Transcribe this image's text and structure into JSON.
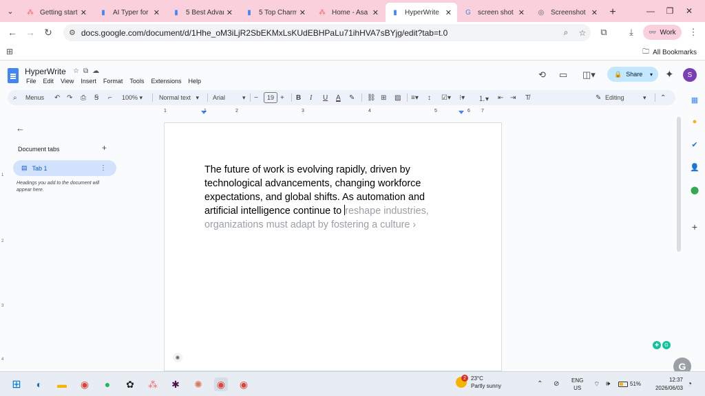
{
  "browser": {
    "tabs": [
      {
        "label": "Getting start",
        "icon": "asana-icon",
        "color": "#f06a6a"
      },
      {
        "label": "AI Typer for",
        "icon": "docs-icon",
        "color": "#4285f4"
      },
      {
        "label": "5 Best Advan",
        "icon": "docs-icon",
        "color": "#4285f4"
      },
      {
        "label": "5 Top Charm",
        "icon": "docs-icon",
        "color": "#4285f4"
      },
      {
        "label": "Home - Asa",
        "icon": "asana-icon",
        "color": "#f06a6a"
      },
      {
        "label": "HyperWrite",
        "icon": "docs-icon",
        "color": "#4285f4",
        "active": true
      },
      {
        "label": "screen shot",
        "icon": "google-icon",
        "color": "#4285f4"
      },
      {
        "label": "Screenshot",
        "icon": "screenshot-icon",
        "color": "#5f6368"
      }
    ],
    "url": "docs.google.com/document/d/1Hhe_oM3iLjR2SbEKMxLsKUdEBHPaLu71ihHVA7sBYjg/edit?tab=t.0",
    "profile_label": "Work",
    "all_bookmarks": "All Bookmarks"
  },
  "docs": {
    "title": "HyperWrite",
    "menus": [
      "File",
      "Edit",
      "View",
      "Insert",
      "Format",
      "Tools",
      "Extensions",
      "Help"
    ],
    "share_label": "Share",
    "avatar_letter": "S",
    "toolbar": {
      "menus_label": "Menus",
      "zoom": "100%",
      "style": "Normal text",
      "font": "Arial",
      "font_size": "19",
      "mode": "Editing"
    },
    "ruler_ticks": [
      "1",
      "1",
      "2",
      "3",
      "4",
      "5",
      "6",
      "7"
    ],
    "vruler_ticks": [
      "1",
      "2",
      "3",
      "4",
      "5"
    ],
    "side_panel": {
      "title": "Document tabs",
      "tab_label": "Tab 1",
      "hint": "Headings you add to the document will appear here."
    },
    "content": {
      "typed": "The future of work is evolving rapidly, driven by technological advancements, changing workforce expectations, and global shifts. As automation and artificial intelligence continue to ",
      "suggestion": "reshape industries, organizations must adapt by fostering a culture ›"
    }
  },
  "taskbar": {
    "weather_badge": "2",
    "temperature": "23°C",
    "condition": "Partly sunny",
    "lang_top": "ENG",
    "lang_bottom": "US",
    "battery": "51%",
    "battery_level": 0.51,
    "time": "12:37",
    "date": "2026/06/03"
  }
}
